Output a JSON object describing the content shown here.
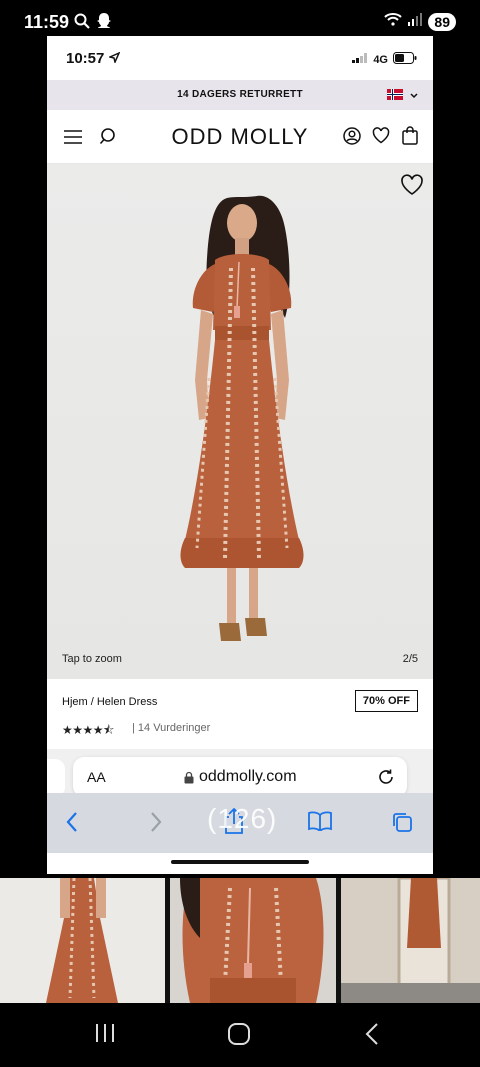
{
  "android_status": {
    "time": "11:59",
    "battery": "89",
    "icons": [
      "search-icon",
      "snapchat-icon",
      "wifi-icon",
      "signal-icon"
    ]
  },
  "ios_status": {
    "time": "10:57",
    "network": "4G",
    "icons": [
      "location-arrow-icon",
      "cell-signal-icon",
      "battery-icon"
    ]
  },
  "banner": {
    "text": "14 DAGERS RETURRETT",
    "flag": "norway-flag-icon",
    "colors": {
      "background": "#e8e4ec"
    }
  },
  "header": {
    "logo": "ODD MOLLY",
    "icons": [
      "menu-icon",
      "search-icon",
      "account-icon",
      "wishlist-icon",
      "bag-icon"
    ]
  },
  "hero": {
    "zoom_hint": "Tap to zoom",
    "pager": "2/5",
    "icons": [
      "heart-icon"
    ],
    "colors": {
      "dress": "#b8603c",
      "background": "#e9e9e7"
    }
  },
  "product": {
    "breadcrumb": "Hjem / Helen Dress",
    "discount": "70% OFF",
    "rating_value": 4.5,
    "rating_stars": "★★★★⯪",
    "reviews": "| 14 Vurderinger"
  },
  "safari": {
    "aa_label": "AA",
    "url": "oddmolly.com",
    "overlay_text": "(126)",
    "icons": [
      "back-icon",
      "forward-icon",
      "share-icon",
      "bookmarks-icon",
      "tabs-icon",
      "reload-icon",
      "lock-icon"
    ],
    "colors": {
      "accent": "#1a73e8"
    }
  },
  "thumbnails": {
    "count": 3
  },
  "android_nav": {
    "icons": [
      "recents-icon",
      "home-icon",
      "back-icon"
    ]
  }
}
